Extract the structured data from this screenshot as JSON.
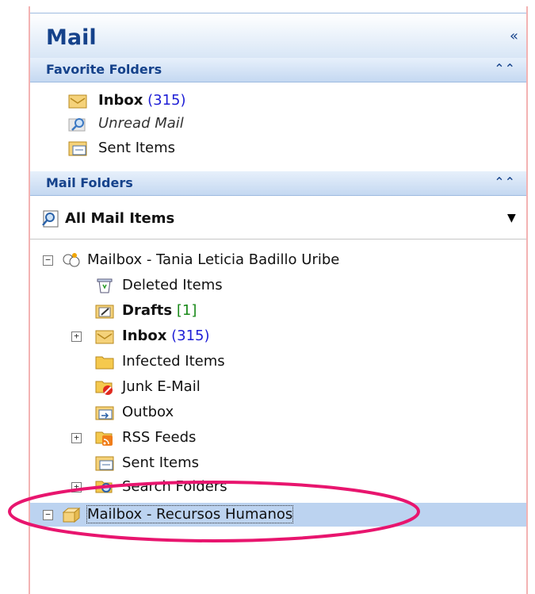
{
  "header": {
    "title": "Mail",
    "collapse_icon": "«"
  },
  "favorites": {
    "title": "Favorite Folders",
    "items": [
      {
        "label": "Inbox",
        "count": "(315)"
      },
      {
        "label": "Unread Mail"
      },
      {
        "label": "Sent Items"
      }
    ]
  },
  "mail_folders": {
    "title": "Mail Folders",
    "view_selector": "All Mail Items",
    "mailbox1": "Mailbox - Tania Leticia Badillo Uribe",
    "folders": [
      {
        "label": "Deleted Items"
      },
      {
        "label": "Drafts",
        "count": "[1]"
      },
      {
        "label": "Inbox",
        "count": "(315)"
      },
      {
        "label": "Infected Items"
      },
      {
        "label": "Junk E-Mail"
      },
      {
        "label": "Outbox"
      },
      {
        "label": "RSS Feeds"
      },
      {
        "label": "Sent Items"
      },
      {
        "label": "Search Folders"
      }
    ],
    "mailbox2": "Mailbox - Recursos Humanos"
  },
  "colors": {
    "accent": "#15428b",
    "highlight_ring": "#e8156e",
    "selection": "#bcd3f0"
  }
}
